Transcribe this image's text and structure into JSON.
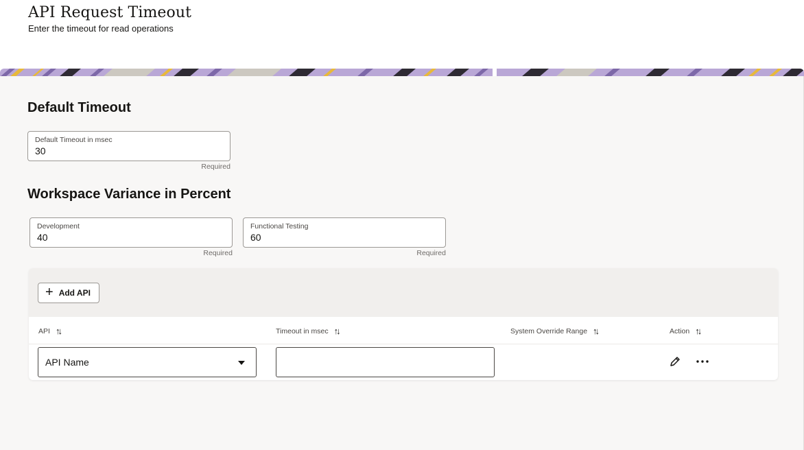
{
  "header": {
    "title": "API Request Timeout",
    "subtitle": "Enter the timeout for read operations"
  },
  "default_timeout": {
    "section_title": "Default Timeout",
    "field": {
      "label": "Default Timeout in msec",
      "value": "30",
      "help": "Required"
    }
  },
  "workspace_variance": {
    "section_title": "Workspace Variance in Percent",
    "fields": [
      {
        "label": "Development",
        "value": "40",
        "help": "Required"
      },
      {
        "label": "Functional Testing",
        "value": "60",
        "help": "Required"
      }
    ]
  },
  "table": {
    "add_button_label": "Add API",
    "columns": [
      "API",
      "Timeout in msec",
      "System Override Range",
      "Action"
    ],
    "rows": [
      {
        "api_select_value": "API Name",
        "timeout_value": "",
        "override_range": ""
      }
    ]
  },
  "icons": {
    "add": "plus-icon",
    "sort": "sort-icon",
    "dropdown": "caret-down-icon",
    "edit": "pencil-icon",
    "more": "more-horizontal-icon"
  },
  "colors": {
    "banner_purple": "#b9a7d6",
    "banner_gold": "#e8b93a",
    "content_background": "#f8f7f6",
    "toolbar_background": "#f1efed"
  }
}
